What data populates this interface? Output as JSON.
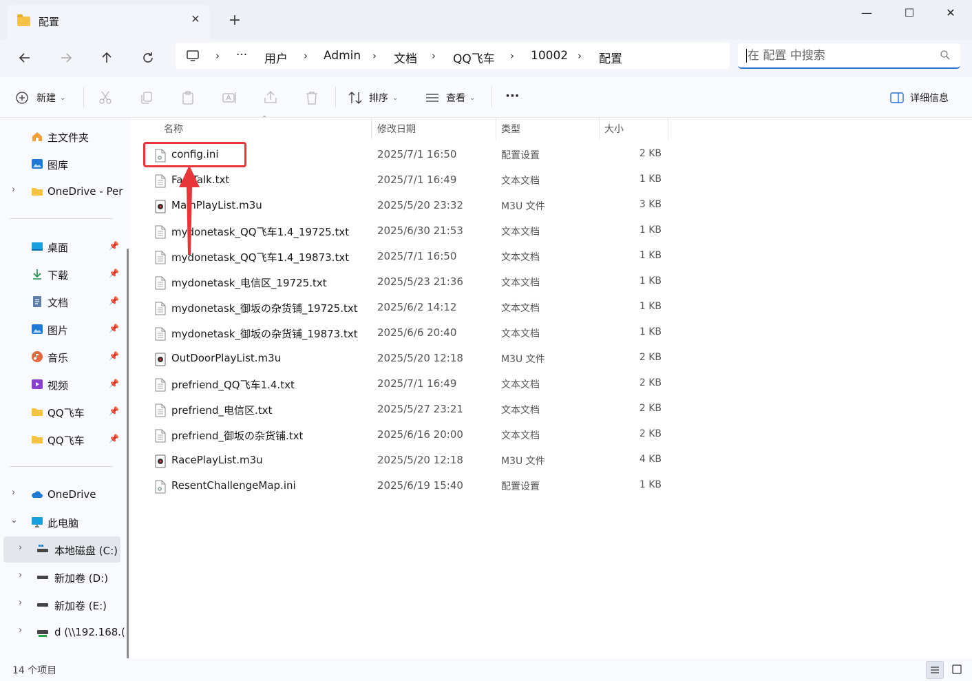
{
  "window": {
    "tab_title": "配置",
    "new_tab": "+",
    "minimize": "—",
    "maximize": "☐",
    "close": "✕"
  },
  "address": {
    "crumbs": [
      "用户",
      "Admin",
      "文档",
      "QQ飞车",
      "10002",
      "配置"
    ],
    "ellipsis": "···",
    "separator": "›"
  },
  "search": {
    "placeholder": "在 配置 中搜索"
  },
  "toolbar": {
    "new_label": "新建",
    "sort_label": "排序",
    "view_label": "查看",
    "more_label": "···",
    "details_label": "详细信息"
  },
  "sidebar": {
    "quick": [
      {
        "label": "主文件夹",
        "icon": "home-icon"
      },
      {
        "label": "图库",
        "icon": "gallery-icon"
      },
      {
        "label": "OneDrive - Per",
        "icon": "folder-icon"
      }
    ],
    "pinned": [
      {
        "label": "桌面",
        "icon": "desktop-icon"
      },
      {
        "label": "下载",
        "icon": "download-icon"
      },
      {
        "label": "文档",
        "icon": "document-icon"
      },
      {
        "label": "图片",
        "icon": "pictures-icon"
      },
      {
        "label": "音乐",
        "icon": "music-icon"
      },
      {
        "label": "视频",
        "icon": "video-icon"
      },
      {
        "label": "QQ飞车",
        "icon": "folder-icon"
      },
      {
        "label": "QQ飞车",
        "icon": "folder-icon"
      }
    ],
    "tree": [
      {
        "label": "OneDrive",
        "icon": "cloud-icon"
      },
      {
        "label": "此电脑",
        "icon": "computer-icon"
      },
      {
        "label": "本地磁盘 (C:)",
        "icon": "drive-icon"
      },
      {
        "label": "新加卷 (D:)",
        "icon": "drive-icon"
      },
      {
        "label": "新加卷 (E:)",
        "icon": "drive-icon"
      },
      {
        "label": "d (\\\\192.168.(",
        "icon": "network-drive-icon"
      }
    ],
    "pin_glyph": "📌"
  },
  "columns": {
    "name": "名称",
    "date": "修改日期",
    "type": "类型",
    "size": "大小"
  },
  "files": [
    {
      "name": "config.ini",
      "date": "2025/7/1 16:50",
      "type": "配置设置",
      "size": "2 KB",
      "kind": "ini"
    },
    {
      "name": "FastTalk.txt",
      "date": "2025/7/1 16:49",
      "type": "文本文档",
      "size": "1 KB",
      "kind": "txt"
    },
    {
      "name": "MainPlayList.m3u",
      "date": "2025/5/20 23:32",
      "type": "M3U 文件",
      "size": "3 KB",
      "kind": "m3u"
    },
    {
      "name": "mydonetask_QQ飞车1.4_19725.txt",
      "date": "2025/6/30 21:53",
      "type": "文本文档",
      "size": "1 KB",
      "kind": "txt"
    },
    {
      "name": "mydonetask_QQ飞车1.4_19873.txt",
      "date": "2025/7/1 16:50",
      "type": "文本文档",
      "size": "1 KB",
      "kind": "txt"
    },
    {
      "name": "mydonetask_电信区_19725.txt",
      "date": "2025/5/23 21:36",
      "type": "文本文档",
      "size": "1 KB",
      "kind": "txt"
    },
    {
      "name": "mydonetask_御坂の杂货铺_19725.txt",
      "date": "2025/6/2 14:12",
      "type": "文本文档",
      "size": "1 KB",
      "kind": "txt"
    },
    {
      "name": "mydonetask_御坂の杂货铺_19873.txt",
      "date": "2025/6/6 20:40",
      "type": "文本文档",
      "size": "1 KB",
      "kind": "txt"
    },
    {
      "name": "OutDoorPlayList.m3u",
      "date": "2025/5/20 12:18",
      "type": "M3U 文件",
      "size": "2 KB",
      "kind": "m3u"
    },
    {
      "name": "prefriend_QQ飞车1.4.txt",
      "date": "2025/7/1 16:49",
      "type": "文本文档",
      "size": "2 KB",
      "kind": "txt"
    },
    {
      "name": "prefriend_电信区.txt",
      "date": "2025/5/27 23:21",
      "type": "文本文档",
      "size": "2 KB",
      "kind": "txt"
    },
    {
      "name": "prefriend_御坂の杂货铺.txt",
      "date": "2025/6/16 20:00",
      "type": "文本文档",
      "size": "2 KB",
      "kind": "txt"
    },
    {
      "name": "RacePlayList.m3u",
      "date": "2025/5/20 12:18",
      "type": "M3U 文件",
      "size": "4 KB",
      "kind": "m3u"
    },
    {
      "name": "ResentChallengeMap.ini",
      "date": "2025/6/19 15:40",
      "type": "配置设置",
      "size": "1 KB",
      "kind": "ini"
    }
  ],
  "status": {
    "item_count": "14 个项目"
  },
  "colors": {
    "accent": "#2a6fd6",
    "annotation": "#e8353a"
  }
}
